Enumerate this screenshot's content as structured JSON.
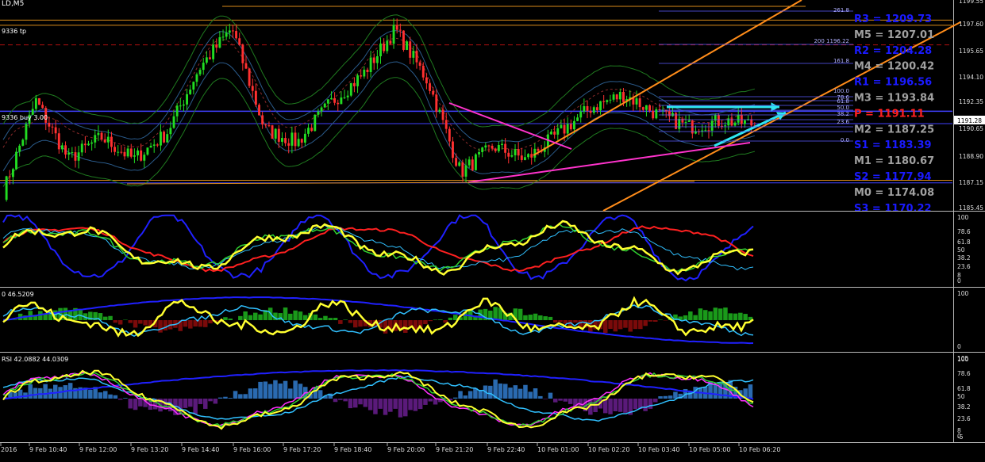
{
  "title": "LD,M5",
  "panes": {
    "main_label_tp": "9336 tp",
    "main_label_buy": "9336 buy 3.00",
    "p2_label": "",
    "p3_label": "0 46.5209",
    "p4_label": "RSI 42.0882 44.0309"
  },
  "pivots": [
    {
      "label": "R3 = 1209.73",
      "color": "#1a1aff"
    },
    {
      "label": "M5 = 1207.01",
      "color": "#a0a0a0"
    },
    {
      "label": "R2 = 1204.28",
      "color": "#1a1aff"
    },
    {
      "label": "M4 = 1200.42",
      "color": "#a0a0a0"
    },
    {
      "label": "R1 = 1196.56",
      "color": "#1a1aff"
    },
    {
      "label": "M3 = 1193.84",
      "color": "#a0a0a0"
    },
    {
      "label": "P   = 1191.11",
      "color": "#ff2020"
    },
    {
      "label": "M2 = 1187.25",
      "color": "#a0a0a0"
    },
    {
      "label": "S1 = 1183.39",
      "color": "#1a1aff"
    },
    {
      "label": "M1 = 1180.67",
      "color": "#a0a0a0"
    },
    {
      "label": "S2 = 1177.94",
      "color": "#1a1aff"
    },
    {
      "label": "M0 = 1174.08",
      "color": "#a0a0a0"
    },
    {
      "label": "S3 = 1170.22",
      "color": "#1a1aff"
    }
  ],
  "fib_labels": [
    "261.8",
    "200 1196.22",
    "161.8",
    "100.0",
    "78.6",
    "61.8",
    "50.0",
    "38.2",
    "23.6",
    "0.0"
  ],
  "chart_data": [
    {
      "type": "line",
      "name": "price",
      "y_ticks": [
        "1199.55",
        "1197.60",
        "1195.65",
        "1194.10",
        "1192.35",
        "1190.65",
        "1188.90",
        "1187.15",
        "1185.45"
      ],
      "current_price": "1191.28",
      "x": [
        "2016",
        "9 Feb 10:40",
        "9 Feb 12:00",
        "9 Feb 13:20",
        "9 Feb 14:40",
        "9 Feb 16:00",
        "9 Feb 17:20",
        "9 Feb 18:40",
        "9 Feb 20:00",
        "9 Feb 21:20",
        "9 Feb 22:40",
        "10 Feb 01:00",
        "10 Feb 02:20",
        "10 Feb 03:40",
        "10 Feb 05:00",
        "10 Feb 06:20"
      ],
      "y": [
        1186.0,
        1193.0,
        1188.5,
        1190.2,
        1188.5,
        1190.5,
        1195.5,
        1198.6,
        1190.8,
        1189.8,
        1192.8,
        1195.0,
        1198.5,
        1194.5,
        1187.5,
        1189.5,
        1188.5,
        1190.5,
        1192.5,
        1193.5,
        1192.0,
        1191.0,
        1191.5,
        1191.2
      ],
      "ylim": [
        1184.8,
        1200.5
      ]
    },
    {
      "type": "line",
      "name": "oscillator 1",
      "y_ticks": [
        "100",
        "78.6",
        "61.8",
        "50",
        "38.2",
        "23.6",
        "8",
        "0"
      ],
      "ylim": [
        0,
        100
      ]
    },
    {
      "type": "line",
      "name": "oscillator 2",
      "y_ticks": [
        "100",
        "0"
      ],
      "ylim": [
        0,
        100
      ]
    },
    {
      "type": "line",
      "name": "RSI",
      "y_ticks": [
        "105",
        "100",
        "78.6",
        "61.8",
        "50",
        "38.2",
        "23.6",
        "8",
        "0",
        "-5"
      ],
      "ylim": [
        -5,
        105
      ]
    }
  ]
}
